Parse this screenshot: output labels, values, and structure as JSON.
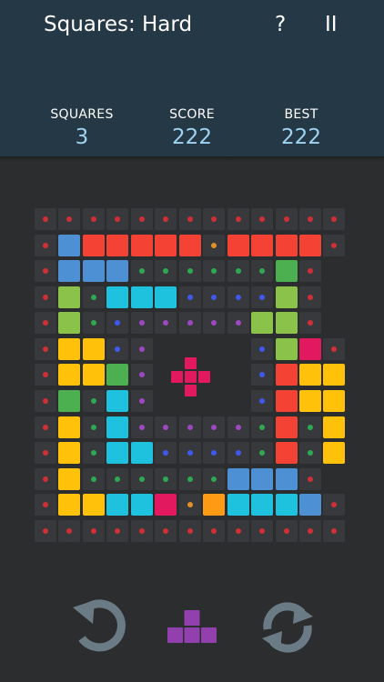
{
  "header": {
    "title": "Squares: Hard",
    "help_label": "?",
    "pause_label": "II",
    "stats": [
      {
        "label": "SQUARES",
        "value": "3"
      },
      {
        "label": "SCORE",
        "value": "222"
      },
      {
        "label": "BEST",
        "value": "222"
      }
    ]
  },
  "colors": {
    "R": "#f44335",
    "B": "#4d90d3",
    "G": "#4caf50",
    "L": "#8bc34a",
    "C": "#1fc2de",
    "Y": "#ffc10a",
    "P": "#e3195f",
    "O": "#ff9a14",
    "empty": "#38393c",
    "dot_red": "#cf2f35",
    "dot_orange": "#e0912a",
    "dot_green": "#2ea851",
    "dot_blue": "#3f59ee",
    "dot_purple": "#9d47c3",
    "icon_gray": "#6b7b85",
    "next_piece": "#9240ae",
    "piece_center": "#e3195f"
  },
  "board": {
    "grid": [
      "rrrrrrrrrrrrr",
      "rBRRRRRoRRRRr",
      "rBBBggggggGr.",
      "rLgCCCbbbbLr.",
      "rLgbpppppLLr.",
      "rYYbp....bLPr",
      "rYYGp....bRYYr",
      "rGgCp....bRYYr",
      "rYgCpppppgRgYr",
      "rYgCCbbbbgRgYr",
      "rYggggggBBBr.",
      "rYYCCPoOCCCBr",
      "rrrrrrrrrrrrr"
    ]
  },
  "center_piece": {
    "name": "plus",
    "color": "#e3195f"
  },
  "controls": {
    "undo_icon": "undo-arrow-icon",
    "next_piece_icon": "t-tetromino-icon",
    "refresh_icon": "refresh-icon"
  }
}
